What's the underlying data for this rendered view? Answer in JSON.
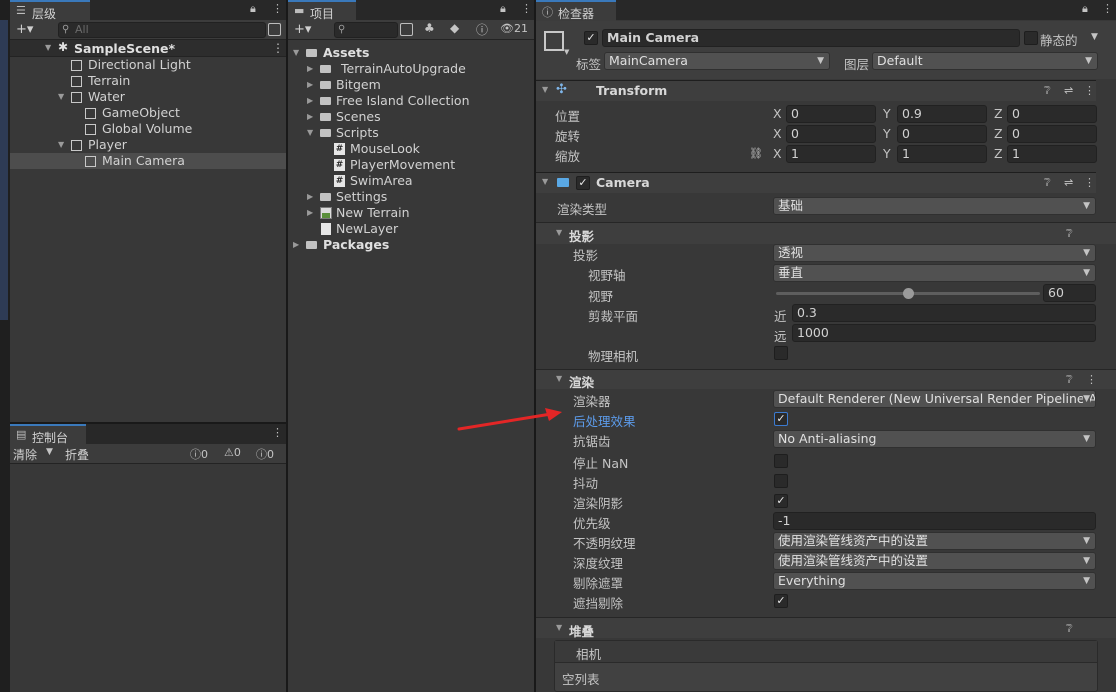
{
  "hierarchy": {
    "tab_label": "层级",
    "search_placeholder": "All",
    "add_label": "+▾",
    "scene_name": "SampleScene*",
    "items": [
      "Directional Light",
      "Terrain",
      "Water",
      "GameObject",
      "Global Volume",
      "Player",
      "Main Camera"
    ]
  },
  "project": {
    "tab_label": "项目",
    "add_label": "+▾",
    "hidden_count": "21",
    "items": [
      "Assets",
      "TerrainAutoUpgrade",
      "Bitgem",
      "Free Island Collection",
      "Scenes",
      "Scripts",
      "MouseLook",
      "PlayerMovement",
      "SwimArea",
      "Settings",
      "New Terrain",
      "NewLayer",
      "Packages"
    ]
  },
  "console": {
    "tab_label": "控制台",
    "clear_label": "清除",
    "collapse_label": "折叠",
    "log_count": "0",
    "warn_count": "0",
    "error_count": "0"
  },
  "inspector": {
    "tab_label": "检查器",
    "object_name": "Main Camera",
    "static_label": "静态的",
    "tag_label": "标签",
    "tag_value": "MainCamera",
    "layer_label": "图层",
    "layer_value": "Default",
    "transform": {
      "title": "Transform",
      "position_label": "位置",
      "rotation_label": "旋转",
      "scale_label": "缩放",
      "axis_x": "X",
      "axis_y": "Y",
      "axis_z": "Z",
      "position": [
        "0",
        "0.9",
        "0"
      ],
      "rotation": [
        "0",
        "0",
        "0"
      ],
      "scale": [
        "1",
        "1",
        "1"
      ]
    },
    "camera": {
      "title": "Camera",
      "render_type_label": "渲染类型",
      "render_type_value": "基础",
      "projection_section": "投影",
      "projection_label": "投影",
      "projection_value": "透视",
      "fov_axis_label": "视野轴",
      "fov_axis_value": "垂直",
      "fov_label": "视野",
      "fov_value": "60",
      "fov_fraction": 0.5,
      "clip_label": "剪裁平面",
      "near_label": "近",
      "near_value": "0.3",
      "far_label": "远",
      "far_value": "1000",
      "physical_label": "物理相机",
      "rendering_section": "渲染",
      "renderer_label": "渲染器",
      "renderer_value": "Default Renderer (New Universal Render Pipeline As",
      "postprocess_label": "后处理效果",
      "antialias_label": "抗锯齿",
      "antialias_value": "No Anti-aliasing",
      "stopnan_label": "停止 NaN",
      "dither_label": "抖动",
      "shadows_label": "渲染阴影",
      "priority_label": "优先级",
      "priority_value": "-1",
      "opaque_label": "不透明纹理",
      "opaque_value": "使用渲染管线资产中的设置",
      "depth_label": "深度纹理",
      "depth_value": "使用渲染管线资产中的设置",
      "culling_label": "剔除遮罩",
      "culling_value": "Everything",
      "occlusion_label": "遮挡剔除",
      "stack_section": "堆叠",
      "stack_header": "相机",
      "stack_empty": "空列表"
    }
  },
  "colors": {
    "arrow": "#e32626",
    "highlight_label": "#5c9bea"
  }
}
